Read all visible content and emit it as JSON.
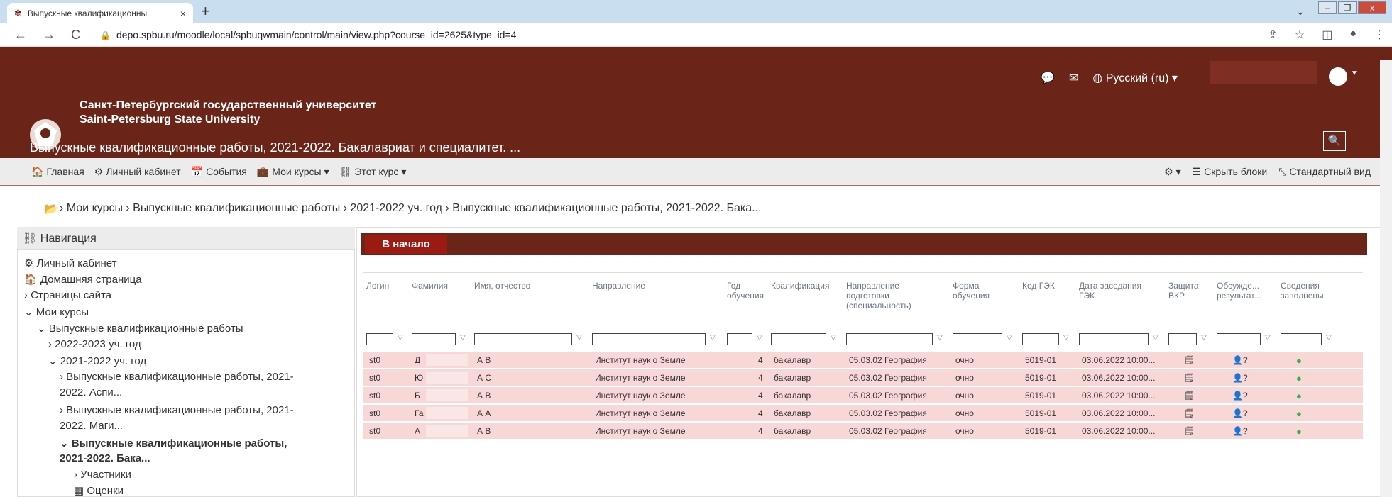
{
  "browser": {
    "tab_title": "Выпускные квалификационны",
    "tab_close": "×",
    "new_tab": "+",
    "url": "depo.spbu.ru/moodle/local/spbuqwmain/control/main/view.php?course_id=2625&type_id=4"
  },
  "header": {
    "uni_ru": "Санкт-Петербургский государственный университет",
    "uni_en": "Saint-Petersburg State University",
    "course_title": "Выпускные квалификационные работы, 2021-2022. Бакалавриат и специалитет. ...",
    "language": "Русский (ru)"
  },
  "navbar": {
    "home": "Главная",
    "cabinet": "Личный кабинет",
    "events": "События",
    "my_courses": "Мои курсы",
    "this_course": "Этот курс",
    "hide_blocks": "Скрыть блоки",
    "standard_view": "Стандартный вид"
  },
  "breadcrumb": "› Мои курсы › Выпускные квалификационные работы › 2021-2022 уч. год › Выпускные квалификационные работы, 2021-2022. Бака...",
  "navigation": {
    "title": "Навигация",
    "items": [
      "Личный кабинет",
      "Домашняя страница",
      "› Страницы сайта",
      "⌄ Мои курсы",
      "⌄ Выпускные квалификационные работы",
      "› 2022-2023 уч. год",
      "⌄ 2021-2022 уч. год",
      "› Выпускные квалификационные работы, 2021-",
      "2022. Аспи...",
      "› Выпускные квалификационные работы, 2021-",
      "2022. Маги...",
      "⌄ Выпускные квалификационные работы,",
      "2021-2022. Бака...",
      "› Участники",
      "Оценки"
    ]
  },
  "main": {
    "start_button": "В начало",
    "columns": [
      "Логин",
      "Фамилия",
      "Имя, отчество",
      "Направление",
      "Год\nобучения",
      "Квалификация",
      "Направление\nподготовки\n(специальность)",
      "Форма\nобучения",
      "Код ГЭК",
      "Дата заседания\nГЭК",
      "Защита\nВКР",
      "Обсужде...\nрезультат...",
      "Сведения\nзаполнены"
    ],
    "rows": [
      {
        "login": "st0",
        "surname": "Д",
        "name": "А      В",
        "dir": "Институт наук о Земле",
        "year": "4",
        "qual": "бакалавр",
        "spec": "05.03.02 География",
        "form": "очно",
        "code": "5019-01",
        "date": "03.06.2022 10:00..."
      },
      {
        "login": "st0",
        "surname": "Ю",
        "name": "А      С",
        "dir": "Институт наук о Земле",
        "year": "4",
        "qual": "бакалавр",
        "spec": "05.03.02 География",
        "form": "очно",
        "code": "5019-01",
        "date": "03.06.2022 10:00..."
      },
      {
        "login": "st0",
        "surname": "Б",
        "name": "А      В",
        "dir": "Институт наук о Земле",
        "year": "4",
        "qual": "бакалавр",
        "spec": "05.03.02 География",
        "form": "очно",
        "code": "5019-01",
        "date": "03.06.2022 10:00..."
      },
      {
        "login": "st0",
        "surname": "Га",
        "name": "А   А",
        "dir": "Институт наук о Земле",
        "year": "4",
        "qual": "бакалавр",
        "spec": "05.03.02 География",
        "form": "очно",
        "code": "5019-01",
        "date": "03.06.2022 10:00..."
      },
      {
        "login": "st0",
        "surname": "А",
        "name": "А      В",
        "dir": "Институт наук о Земле",
        "year": "4",
        "qual": "бакалавр",
        "spec": "05.03.02 География",
        "form": "очно",
        "code": "5019-01",
        "date": "03.06.2022 10:00..."
      }
    ]
  },
  "icons": {
    "defense": "report-icon",
    "discussion": "question-person-icon",
    "filled": "check-circle-icon"
  },
  "colors": {
    "header": "#6b2418",
    "button": "#9b1a12",
    "row": "#f8d7d7",
    "check": "#2fb24f"
  }
}
